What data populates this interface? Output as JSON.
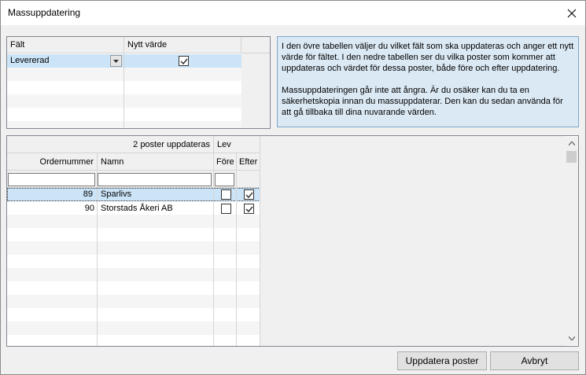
{
  "window": {
    "title": "Massuppdatering"
  },
  "field_table": {
    "headers": {
      "field": "Fält",
      "new_value": "Nytt värde"
    },
    "row": {
      "field": "Levererad",
      "new_value_checked": true
    }
  },
  "info_text": "I den övre tabellen väljer du vilket fält som ska uppdateras och anger ett nytt värde för fältet. I den nedre tabellen ser du vilka poster som kommer att uppdateras och värdet för dessa poster, både före och efter uppdatering.\n\nMassuppdateringen går inte att ångra. Är du osäker kan du ta en säkerhetskopia innan du massuppdaterar. Den kan du sedan använda för att gå tillbaka till dina nuvarande värden.",
  "records_table": {
    "summary": "2 poster uppdateras",
    "group_header": "Lev",
    "headers": {
      "order": "Ordernummer",
      "name": "Namn",
      "before": "Före",
      "after": "Efter"
    },
    "rows": [
      {
        "order": "89",
        "name": "Sparlivs",
        "before": false,
        "after": true
      },
      {
        "order": "90",
        "name": "Storstads Åkeri AB",
        "before": false,
        "after": true
      }
    ]
  },
  "buttons": {
    "update": "Uppdatera poster",
    "cancel": "Avbryt"
  },
  "icons": {
    "close": "close-icon",
    "dropdown": "chevron-down-icon",
    "check": "checkmark-icon",
    "scroll_up": "scroll-up-icon",
    "scroll_down": "scroll-down-icon"
  },
  "colors": {
    "selection": "#cce4f7",
    "info_bg": "#dbe9f4",
    "info_border": "#7aa7cc"
  }
}
